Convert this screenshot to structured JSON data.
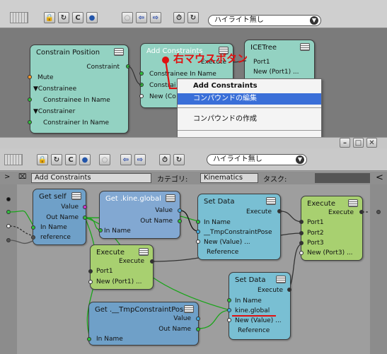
{
  "top_window": {
    "toolbar": {
      "highlight_dropdown": "ハイライト無し",
      "buttons": [
        "lock-icon",
        "refresh-icon",
        "c-icon",
        "globe-icon",
        "circle-icon",
        "back-arrow-icon",
        "forward-arrow-icon",
        "timer-icon",
        "refresh2-icon"
      ]
    },
    "nodes": {
      "constrain_position": {
        "title": "Constrain Position",
        "ports": [
          "Constraint",
          "Mute",
          "▼Constrainee",
          "Constrainee In Name",
          "▼Constrainer",
          "Constrainer In Name"
        ]
      },
      "add_constraints": {
        "title": "Add Constraints",
        "ports": [
          "Constrainee In Name",
          "Constrai",
          "New (Co"
        ]
      },
      "ice_tree": {
        "title": "ICETree",
        "ports": [
          "Port1",
          "New (Port1) ..."
        ]
      },
      "execute_label": "Execute"
    },
    "annotation": "右マウスボタン",
    "context_menu": {
      "items": [
        "Add Constraints",
        "コンパウンドの編集",
        "コンパウンドの作成"
      ]
    }
  },
  "bottom_window": {
    "title_buttons": [
      "minimize-icon",
      "maximize-icon",
      "close-icon"
    ],
    "toolbar": {
      "highlight_dropdown": "ハイライト無し"
    },
    "header": {
      "compound_name": "Add Constraints",
      "category_label": "カテゴリ:",
      "category_value": "Kinematics",
      "task_label": "タスク:",
      "task_value": ""
    },
    "nodes": {
      "get_self": {
        "title": "Get self",
        "ports": [
          "Value",
          "Out Name",
          "In Name",
          "reference"
        ]
      },
      "get_kine_global": {
        "title": "Get .kine.global",
        "ports": [
          "Value",
          "Out Name",
          "In Name"
        ]
      },
      "set_data_1": {
        "title": "Set Data",
        "ports": [
          "Execute",
          "In Name",
          "__TmpConstraintPose",
          "New (Value) ...",
          "Reference"
        ]
      },
      "execute_right": {
        "title": "Execute",
        "ports": [
          "Execute",
          "Port1",
          "Port2",
          "Port3",
          "New (Port3) ..."
        ]
      },
      "execute_mid": {
        "title": "Execute",
        "ports": [
          "Execute",
          "Port1",
          "New (Port1) ..."
        ]
      },
      "set_data_2": {
        "title": "Set Data",
        "ports": [
          "Execute",
          "In Name",
          "kine.global",
          "New (Value) ...",
          "Reference"
        ]
      },
      "get_tmp_pose": {
        "title": "Get .__TmpConstraintPose",
        "ports": [
          "Value",
          "Out Name",
          "In Name"
        ]
      }
    }
  },
  "colors": {
    "highlight": "#3a6fd8",
    "annotation": "#e01010",
    "wire_green": "#1aa51a"
  }
}
